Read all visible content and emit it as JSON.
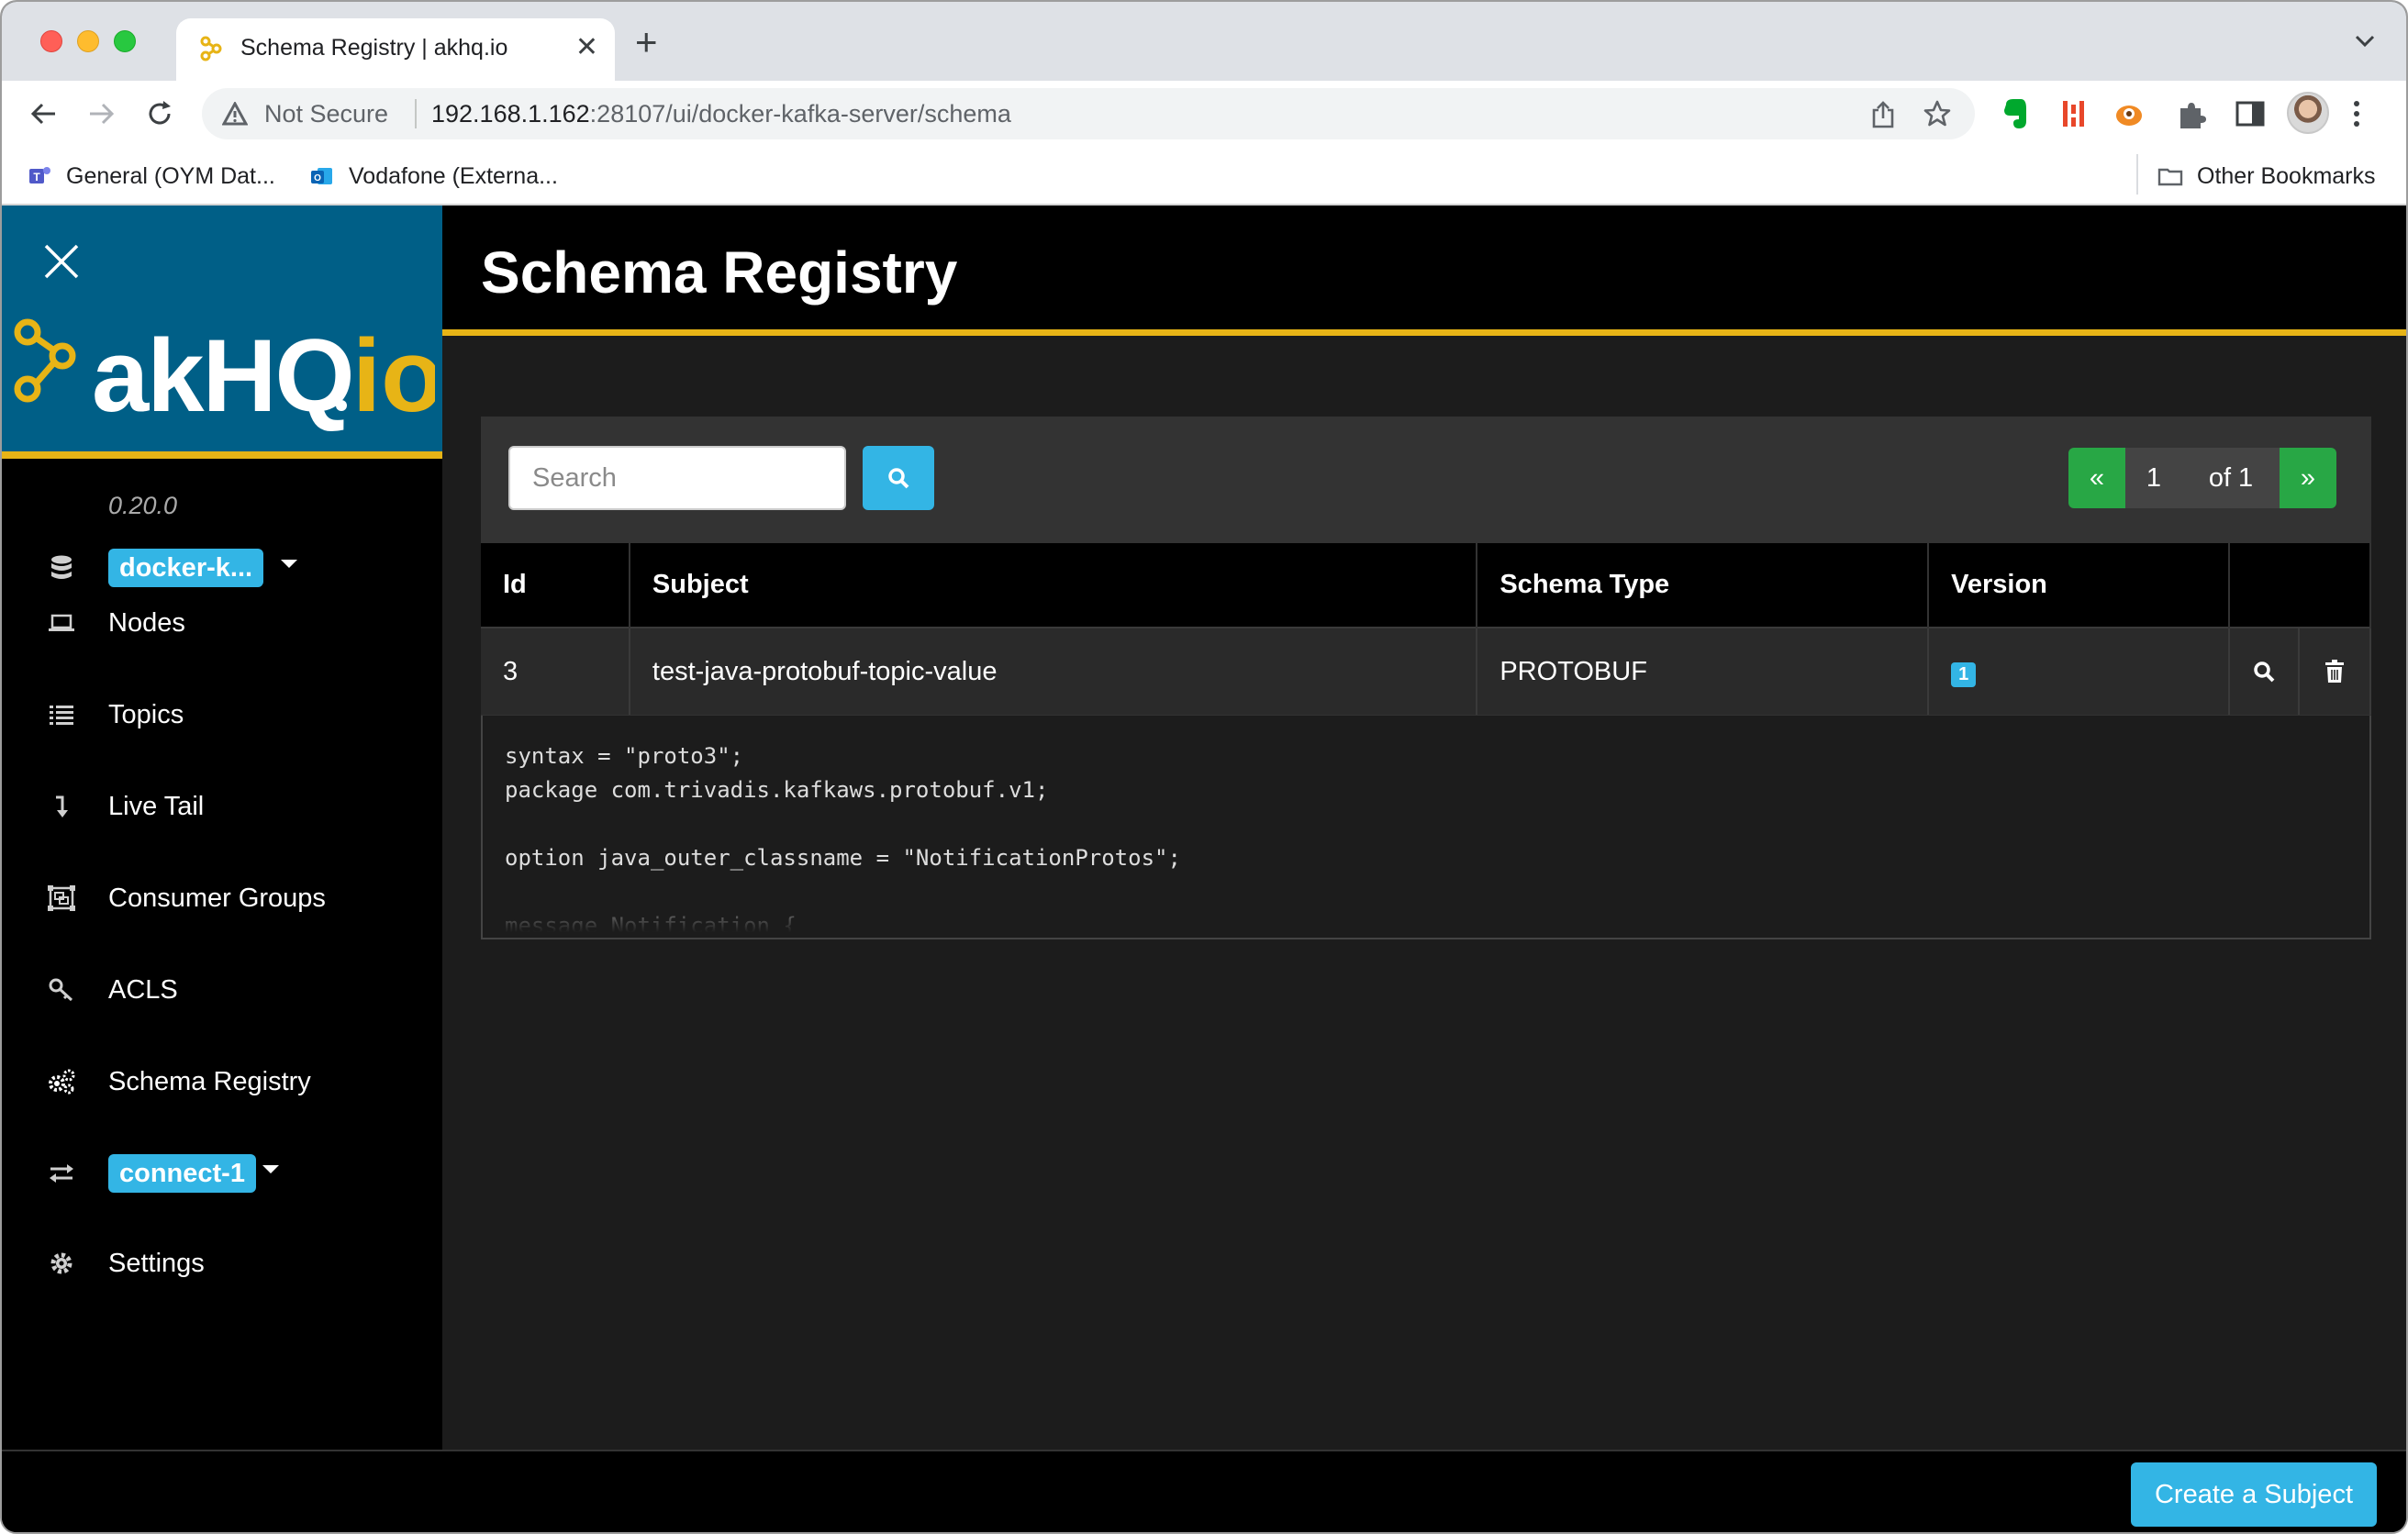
{
  "browser": {
    "tab_title": "Schema Registry | akhq.io",
    "not_secure": "Not Secure",
    "url_host": "192.168.1.162",
    "url_rest": ":28107/ui/docker-kafka-server/schema",
    "bookmarks": [
      "General (OYM Dat...",
      "Vodafone (Externa..."
    ],
    "other_bookmarks": "Other Bookmarks"
  },
  "sidebar": {
    "version": "0.20.0",
    "cluster_badge": "docker-k...",
    "connect_badge": "connect-1",
    "items": {
      "nodes": "Nodes",
      "topics": "Topics",
      "live_tail": "Live Tail",
      "consumer_groups": "Consumer Groups",
      "acls": "ACLS",
      "schema_registry": "Schema Registry",
      "settings": "Settings"
    }
  },
  "header": {
    "title": "Schema Registry"
  },
  "search": {
    "placeholder": "Search",
    "value": ""
  },
  "pagination": {
    "prev": "«",
    "page": "1",
    "of": "of 1",
    "next": "»"
  },
  "table": {
    "columns": [
      "Id",
      "Subject",
      "Schema Type",
      "Version"
    ],
    "rows": [
      {
        "id": "3",
        "subject": "test-java-protobuf-topic-value",
        "schema_type": "PROTOBUF",
        "version": "1"
      }
    ],
    "schema_preview": "syntax = \"proto3\";\npackage com.trivadis.kafkaws.protobuf.v1;\n\noption java_outer_classname = \"NotificationProtos\";\n\nmessage Notification {"
  },
  "footer": {
    "create_button": "Create a Subject"
  },
  "colors": {
    "accent": "#33b5e5",
    "brand_yellow": "#e7b416",
    "brand_blue": "#005f87",
    "success": "#28a745"
  }
}
